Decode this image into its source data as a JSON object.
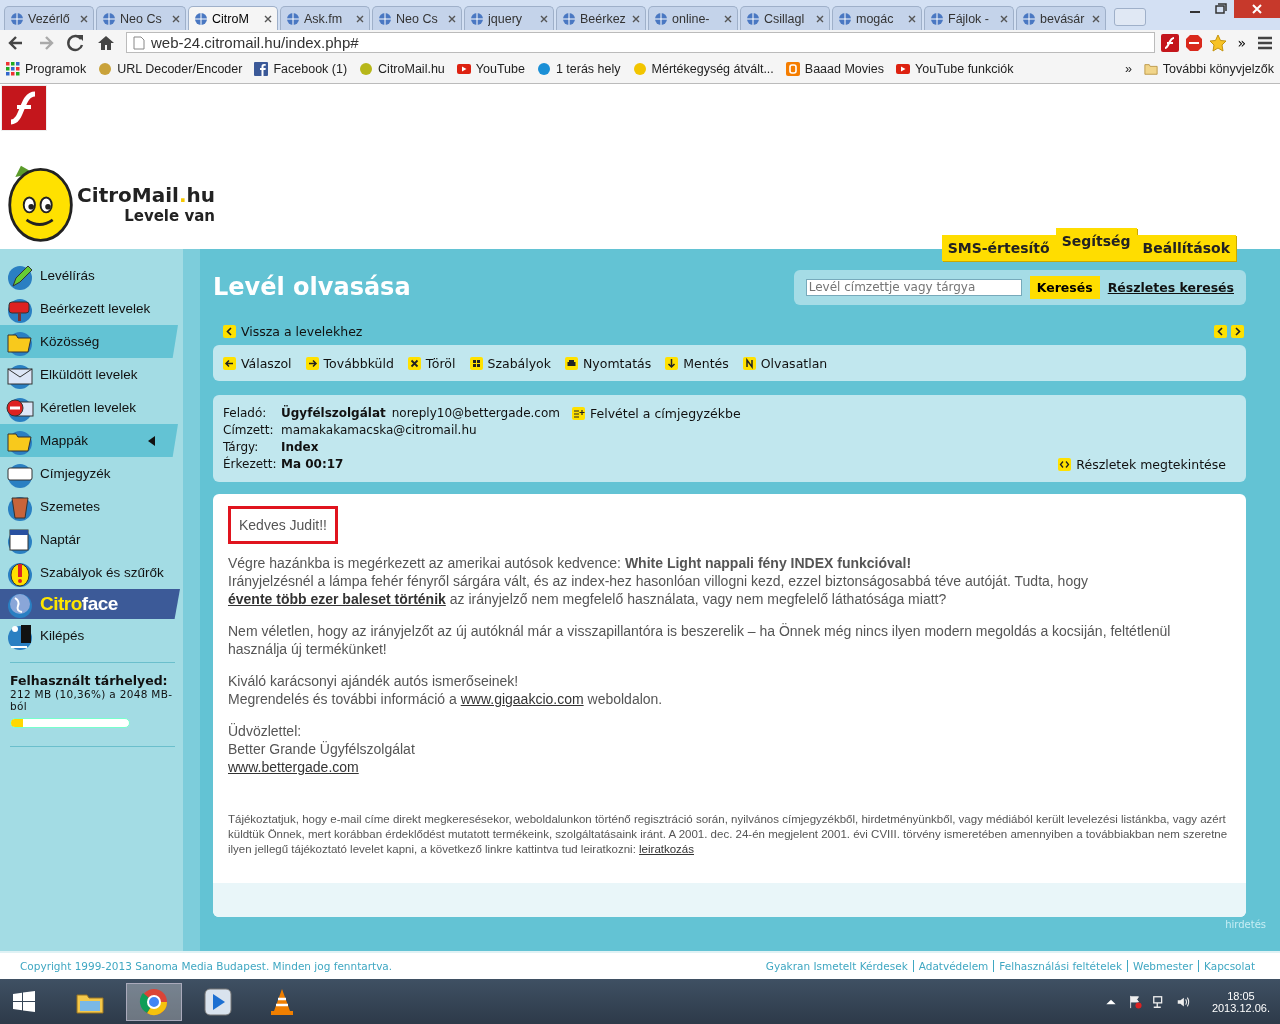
{
  "browser": {
    "tabs": [
      {
        "label": "Vezérlő",
        "selected": false
      },
      {
        "label": "Neo Cs",
        "selected": false
      },
      {
        "label": "CitroM",
        "selected": true
      },
      {
        "label": "Ask.fm",
        "selected": false
      },
      {
        "label": "Neo Cs",
        "selected": false
      },
      {
        "label": "jquery",
        "selected": false
      },
      {
        "label": "Beérkez",
        "selected": false
      },
      {
        "label": "online-",
        "selected": false
      },
      {
        "label": "Csillagl",
        "selected": false
      },
      {
        "label": "mogác",
        "selected": false
      },
      {
        "label": "Fájlok -",
        "selected": false
      },
      {
        "label": "bevásár",
        "selected": false
      }
    ],
    "url": "web-24.citromail.hu/index.php#",
    "extensions_overflow": "»",
    "bookmarks": [
      "Programok",
      "URL Decoder/Encoder",
      "Facebook (1)",
      "CitroMail.hu",
      "YouTube",
      "1 terás hely",
      "Mértékegység átvált...",
      "Baaad Movies",
      "YouTube funkciók"
    ],
    "bookmarks_overflow": "»",
    "other_bookmarks": "További könyvjelzők"
  },
  "site": {
    "logo_name": "CitroMail",
    "logo_dot": ".",
    "logo_domain": "hu",
    "tagline": "Levele van",
    "top_tabs": [
      "SMS-értesítő",
      "Segítség",
      "Beállítások"
    ]
  },
  "sidebar": {
    "items": [
      {
        "label": "Levélírás",
        "kind": "plain",
        "has_submenu": false
      },
      {
        "label": "Beérkezett levelek",
        "kind": "plain",
        "has_submenu": false
      },
      {
        "label": "Közösség",
        "kind": "band",
        "has_submenu": false
      },
      {
        "label": "Elküldött levelek",
        "kind": "plain",
        "has_submenu": false
      },
      {
        "label": "Kéretlen levelek",
        "kind": "plain",
        "has_submenu": false
      },
      {
        "label": "Mappák",
        "kind": "band",
        "has_submenu": true
      },
      {
        "label": "Címjegyzék",
        "kind": "plain",
        "has_submenu": false
      },
      {
        "label": "Szemetes",
        "kind": "plain",
        "has_submenu": false
      },
      {
        "label": "Naptár",
        "kind": "plain",
        "has_submenu": false
      },
      {
        "label": "Szabályok és szűrők",
        "kind": "plain",
        "has_submenu": false
      },
      {
        "label": "Citro",
        "label_2": "face",
        "kind": "brand",
        "has_submenu": false
      },
      {
        "label": "Kilépés",
        "kind": "plain",
        "has_submenu": false
      }
    ],
    "storage": {
      "title": "Felhasznált tárhelyed:",
      "text": "212 MB (10,36%) a 2048 MB-ból",
      "level": 0.1036
    }
  },
  "main": {
    "title": "Levél olvasása",
    "search": {
      "placeholder": "Levél címzettje vagy tárgya",
      "button": "Keresés",
      "advanced": "Részletes keresés"
    },
    "back": "Vissza a levelekhez",
    "toolbar": [
      "Válaszol",
      "Továbbküld",
      "Töröl",
      "Szabályok",
      "Nyomtatás",
      "Mentés",
      "Olvasatlan"
    ],
    "header": {
      "from": {
        "label": "Feladó:",
        "name": "Ügyfélszolgálat",
        "email": "noreply10@bettergade.com",
        "action": "Felvétel a címjegyzékbe"
      },
      "rows": [
        {
          "label": "Címzett:",
          "value": "mamakakamacska@citromail.hu",
          "kind": "plain"
        },
        {
          "label": "Tárgy:",
          "value": "Index",
          "kind": "strong"
        },
        {
          "label": "Érkezett:",
          "value": "Ma 00:17",
          "kind": "strong"
        }
      ],
      "details": "Részletek megtekintése"
    },
    "body": {
      "greeting": "Kedves Judit!!",
      "greeting_highlighted": true,
      "blocks": [
        {
          "lines": [
            [
              {
                "kind": "text",
                "text": "Végre hazánkba is megérkezett az amerikai autósok kedvence: **White Light nappali fény INDEX funkcióval!**"
              }
            ],
            [
              {
                "kind": "text",
                "text": "Irányjelzésnél a lámpa fehér fényről sárgára vált, és az index-hez hasonlóan villogni kezd, ezzel biztonságosabbá téve autóját. Tudta, hogy"
              },
              {
                "kind": "link",
                "bold": true,
                "text": "évente több ezer baleset történik"
              },
              {
                "kind": "text",
                "text": "az irányjelző nem megfelelő használata, vagy nem megfelelő láthatósága miatt?"
              }
            ]
          ]
        },
        {
          "lines": [
            [
              {
                "kind": "text",
                "text": "Nem véletlen, hogy az irányjelzőt az új autóknál már a visszapillantóra is beszerelik – ha Önnek még nincs ilyen modern megoldás a kocsiján, feltétlenül használja új termékünket!"
              }
            ]
          ]
        },
        {
          "lines": [
            [
              {
                "kind": "text",
                "text": "Kiváló karácsonyi ajándék autós ismerőseinek!"
              }
            ],
            [
              {
                "kind": "text",
                "text": "Megrendelés és további információ a"
              },
              {
                "kind": "link",
                "bold": false,
                "text": "www.gigaakcio.com"
              },
              {
                "kind": "text",
                "text": "weboldalon."
              }
            ]
          ]
        },
        {
          "lines": [
            [
              {
                "kind": "text",
                "text": "Üdvözlettel:"
              }
            ],
            [
              {
                "kind": "text",
                "text": "Better Grande Ügyfélszolgálat"
              }
            ],
            [
              {
                "kind": "link",
                "bold": false,
                "text": "www.bettergade.com"
              }
            ]
          ]
        }
      ],
      "disclaimer": [
        {
          "kind": "text",
          "text": "Tájékoztatjuk, hogy e-mail címe direkt megkeresésekor, weboldalunkon történő regisztráció során, nyilvános címjegyzékből, hirdetményünkből, vagy médiából került levelezési listánkba, vagy azért küldtük Önnek, mert korábban érdeklődést mutatott termékeink, szolgáltatásaink iránt. A 2001. dec. 24-én megjelent 2001. évi CVIII. törvény ismeretében amennyiben a továbbiakban nem szeretne ilyen jellegű tájékoztató levelet kapni, a következő linkre kattintva tud leiratkozni:"
        },
        {
          "kind": "link",
          "bold": false,
          "text": "leiratkozás"
        }
      ]
    },
    "ad_label": "hirdetés"
  },
  "footer": {
    "copyright": "Copyright 1999-2013 Sanoma Media Budapest. Minden jog fenntartva.",
    "links": [
      "Gyakran Ismetelt Kérdesek",
      "Adatvédelem",
      "Felhasználási feltételek",
      "Webmester",
      "Kapcsolat"
    ]
  },
  "taskbar": {
    "apps": [
      {
        "selected": false
      },
      {
        "selected": true
      },
      {
        "selected": false
      },
      {
        "selected": false
      }
    ],
    "time": "18:05",
    "date": "2013.12.06."
  }
}
